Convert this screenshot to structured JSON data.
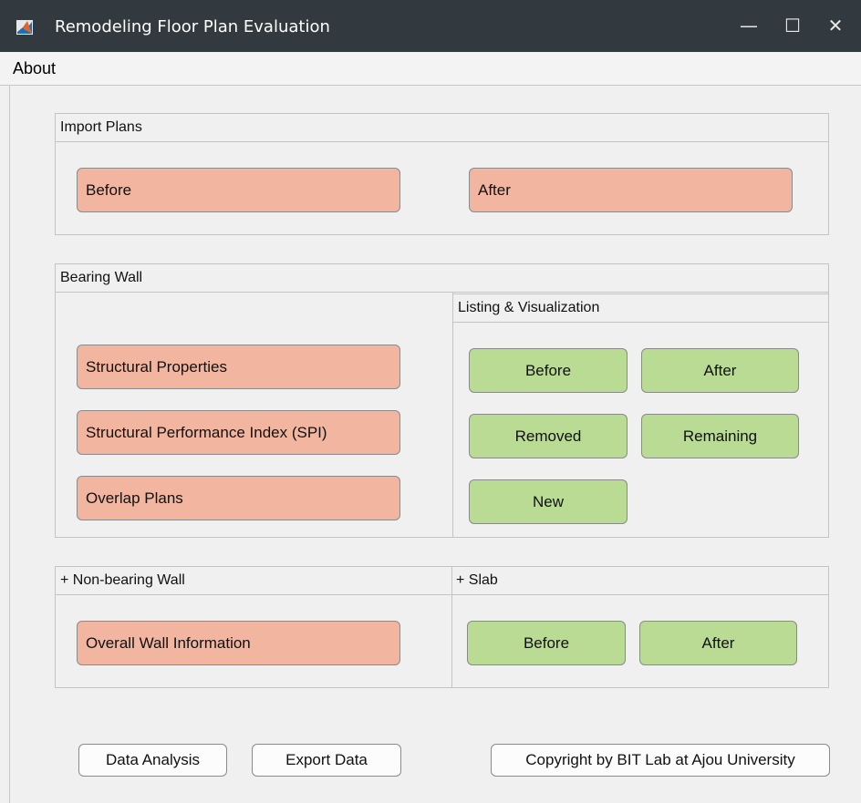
{
  "window": {
    "title": "Remodeling Floor Plan Evaluation",
    "minimize": "—",
    "maximize": "☐",
    "close": "✕"
  },
  "menu": {
    "about": "About"
  },
  "import_plans": {
    "title": "Import Plans",
    "before": "Before",
    "after": "After"
  },
  "bearing_wall": {
    "title": "Bearing Wall",
    "structural_properties": "Structural Properties",
    "spi": "Structural Performance Index (SPI)",
    "overlap_plans": "Overlap Plans",
    "listing": {
      "title": "Listing & Visualization",
      "before": "Before",
      "after": "After",
      "removed": "Removed",
      "remaining": "Remaining",
      "new": "New"
    }
  },
  "non_bearing": {
    "title": "+ Non-bearing Wall",
    "overall": "Overall Wall Information"
  },
  "slab": {
    "title": "+ Slab",
    "before": "Before",
    "after": "After"
  },
  "footer": {
    "data_analysis": "Data Analysis",
    "export_data": "Export Data",
    "copyright": "Copyright by BIT Lab at Ajou University"
  },
  "colors": {
    "action_button": "#f2b6a0",
    "view_button": "#b9db93",
    "titlebar": "#333a3f"
  }
}
